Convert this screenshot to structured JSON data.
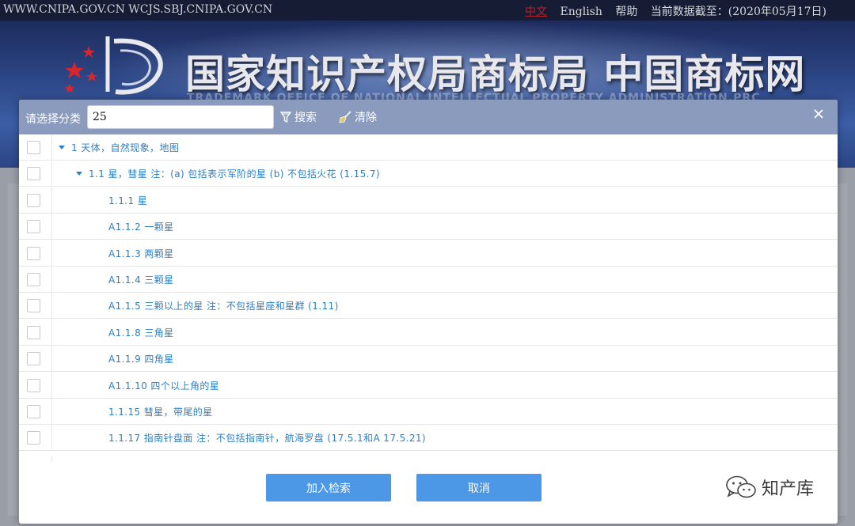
{
  "topbar": {
    "urls": "WWW.CNIPA.GOV.CN WCJS.SBJ.CNIPA.GOV.CN",
    "lang_cn": "中文",
    "lang_en": "English",
    "help": "帮助",
    "data_date": "当前数据截至：(2020年05月17日)"
  },
  "banner": {
    "title": "国家知识产权局商标局 中国商标网",
    "subtitle": "TRADEMARK OFFICE OF NATIONAL INTELLECTUAL PROPERTY ADMINISTRATION,PRC"
  },
  "modal": {
    "category_label": "请选择分类",
    "search_value": "25",
    "search_button": "搜索",
    "clear_button": "清除",
    "close_icon": "close-icon",
    "rows": [
      {
        "text": "1 天体，自然现象，地图",
        "level": 0,
        "expandable": true
      },
      {
        "text": "1.1 星，彗星 注：(a) 包括表示军阶的星 (b) 不包括火花 (1.15.7)",
        "level": 1,
        "expandable": true
      },
      {
        "text": "1.1.1 星",
        "level": 2,
        "expandable": false
      },
      {
        "text": "A1.1.2 一颗星",
        "level": 2,
        "expandable": false
      },
      {
        "text": "A1.1.3 两颗星",
        "level": 2,
        "expandable": false
      },
      {
        "text": "A1.1.4 三颗星",
        "level": 2,
        "expandable": false
      },
      {
        "text": "A1.1.5 三颗以上的星 注：不包括星座和星群 (1.11)",
        "level": 2,
        "expandable": false
      },
      {
        "text": "A1.1.8 三角星",
        "level": 2,
        "expandable": false
      },
      {
        "text": "A1.1.9 四角星",
        "level": 2,
        "expandable": false
      },
      {
        "text": "A1.1.10 四个以上角的星",
        "level": 2,
        "expandable": false
      },
      {
        "text": "1.1.15 彗星，带尾的星",
        "level": 2,
        "expandable": false
      },
      {
        "text": "1.1.17 指南针盘面 注：不包括指南针，航海罗盘 (17.5.1和A 17.5.21)",
        "level": 2,
        "expandable": false
      }
    ],
    "add_button": "加入检索",
    "cancel_button": "取消"
  },
  "watermark": {
    "text": "知产库"
  },
  "colors": {
    "link_blue": "#2b7fc6",
    "header_bg": "#8b9bbd",
    "button_blue": "#4c97e6",
    "banner_navy": "#1d2b5c"
  }
}
